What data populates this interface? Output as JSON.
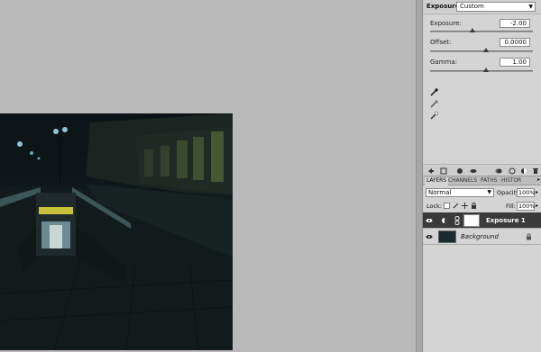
{
  "adjustments": {
    "title": "Exposure",
    "preset": "Custom",
    "fields": [
      {
        "label": "Exposure:",
        "value": "-2.00",
        "fraction": 0.45
      },
      {
        "label": "Offset:",
        "value": "0.0000",
        "fraction": 0.5
      },
      {
        "label": "Gamma:",
        "value": "1.00",
        "fraction": 0.5
      }
    ],
    "eyedroppers": [
      "black-point-eyedropper-icon",
      "gray-point-eyedropper-icon",
      "white-point-eyedropper-icon"
    ]
  },
  "layers_panel": {
    "tabs": [
      "LAYERS",
      "CHANNELS",
      "PATHS",
      "HISTOR"
    ],
    "blend_mode": "Normal",
    "opacity_label": "Opacity:",
    "opacity_value": "100%",
    "lock_label": "Lock:",
    "fill_label": "Fill:",
    "fill_value": "100%",
    "layers": [
      {
        "name": "Exposure 1",
        "selected": true
      },
      {
        "name": "Background",
        "selected": false
      }
    ]
  },
  "colors": {
    "canvas_bg": "#b9b9b9",
    "panel_bg": "#d4d4d4",
    "selected_layer": "#3a3a3a"
  }
}
